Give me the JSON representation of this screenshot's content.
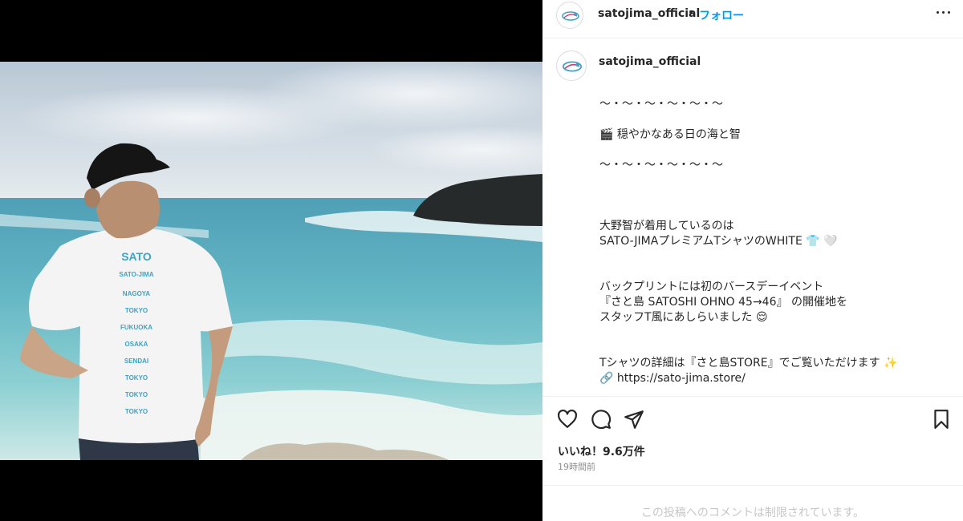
{
  "post": {
    "username": "satojima_official",
    "separator": "•",
    "follow_label": "フォロー",
    "more_icon": "more-options-icon"
  },
  "caption": {
    "username": "satojima_official",
    "lines": [
      "～・～・～・～・～・～",
      "",
      "🎬 穏やかなある日の海と智",
      "",
      "～・～・～・～・～・～",
      "",
      "",
      "",
      "大野智が着用しているのは",
      "SATO-JIMAプレミアムTシャツのWHITE 👕 🤍",
      "",
      "",
      "バックプリントには初のバースデーイベント",
      "『さと島 SATOSHI OHNO 45→46』 の開催地を",
      "スタッフT風にあしらいました 😌",
      "",
      "",
      "Tシャツの詳細は『さと島STORE』でご覧いただけます ✨",
      "🔗 https://sato-jima.store/"
    ]
  },
  "actions": {
    "like_icon": "heart-icon",
    "comment_icon": "comment-icon",
    "share_icon": "share-icon",
    "save_icon": "bookmark-icon"
  },
  "stats": {
    "likes": "いいね！9.6万件",
    "time": "19時間前"
  },
  "comments": {
    "disabled_text": "この投稿へのコメントは制限されています。"
  },
  "photo": {
    "shirt_text": [
      "SATO-JIMA",
      "NAGOYA",
      "TOKYO",
      "FUKUOKA",
      "OSAKA",
      "SENDAI",
      "TOKYO",
      "TOKYO",
      "TOKYO"
    ]
  },
  "colors": {
    "follow": "#0095f6",
    "text": "#262626",
    "muted": "#8e8e8e",
    "border": "#efefef"
  }
}
